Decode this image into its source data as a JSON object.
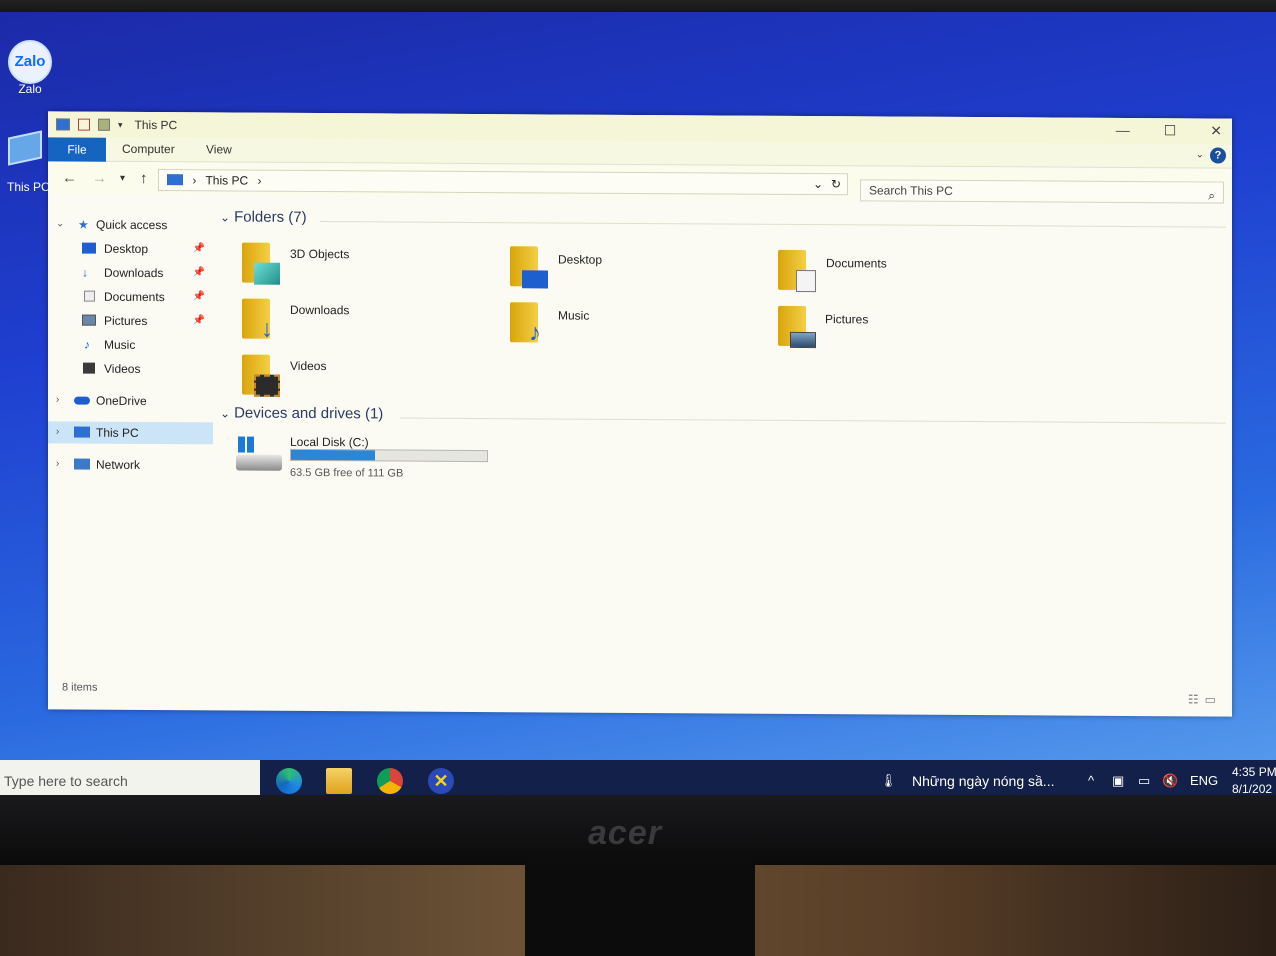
{
  "desktop": {
    "icons": [
      {
        "label": "Zalo",
        "icon": "zalo-app-icon",
        "badge_text": "Zalo"
      },
      {
        "label": "This PC",
        "icon": "computer-icon"
      }
    ]
  },
  "window": {
    "title": "This PC",
    "buttons": {
      "minimize": "—",
      "maximize": "☐",
      "close": "✕"
    },
    "ribbon_tabs": [
      "File",
      "Computer",
      "View"
    ],
    "help": "?",
    "address": {
      "path": [
        "This PC"
      ],
      "sep": "›"
    },
    "search_placeholder": "Search This PC",
    "nav": {
      "quick_access": "Quick access",
      "pinned": [
        {
          "label": "Desktop",
          "icon": "desktop-icon",
          "pinned": true
        },
        {
          "label": "Downloads",
          "icon": "download-arrow-icon",
          "pinned": true
        },
        {
          "label": "Documents",
          "icon": "documents-icon",
          "pinned": true
        },
        {
          "label": "Pictures",
          "icon": "pictures-icon",
          "pinned": true
        },
        {
          "label": "Music",
          "icon": "music-note-icon",
          "pinned": false
        },
        {
          "label": "Videos",
          "icon": "video-icon",
          "pinned": false
        }
      ],
      "onedrive": "OneDrive",
      "this_pc": "This PC",
      "network": "Network"
    },
    "folders_header": "Folders (7)",
    "folders": [
      {
        "label": "3D Objects",
        "icon": "3d-cube-icon"
      },
      {
        "label": "Desktop",
        "icon": "desktop-icon"
      },
      {
        "label": "Documents",
        "icon": "documents-icon"
      },
      {
        "label": "Downloads",
        "icon": "download-arrow-icon"
      },
      {
        "label": "Music",
        "icon": "music-note-icon"
      },
      {
        "label": "Pictures",
        "icon": "pictures-icon"
      },
      {
        "label": "Videos",
        "icon": "video-icon"
      }
    ],
    "drives_header": "Devices and drives (1)",
    "drive": {
      "label": "Local Disk (C:)",
      "free_text": "63.5 GB free of 111 GB",
      "used_fraction": 0.43
    },
    "status": "8 items"
  },
  "taskbar": {
    "search_placeholder": "Type here to search",
    "apps": [
      "edge-icon",
      "file-explorer-icon",
      "chrome-icon",
      "app-icon"
    ],
    "news": "Những ngày nóng sầ...",
    "lang": "ENG",
    "time": "4:35 PM",
    "date": "8/1/202"
  },
  "monitor_brand": "acer",
  "colors": {
    "accent": "#1565c0",
    "selection": "#cce4f7",
    "folder": "#f3cf46",
    "desktop": "#1f3fd0"
  }
}
